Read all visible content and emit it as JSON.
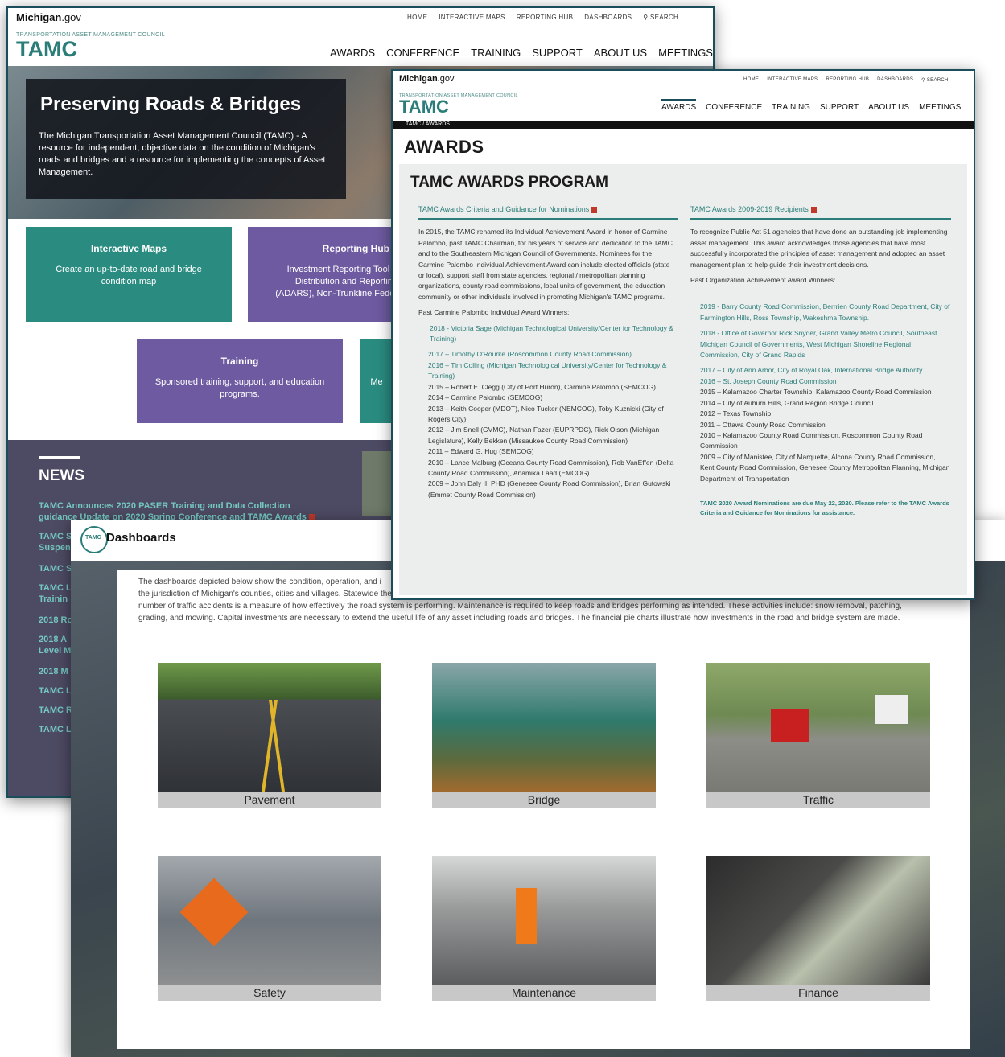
{
  "home": {
    "brand": {
      "michigan": "Michigan",
      "gov": ".gov",
      "subtitle": "TRANSPORTATION ASSET MANAGEMENT COUNCIL",
      "tamc": "TAMC"
    },
    "util_nav": [
      "HOME",
      "INTERACTIVE MAPS",
      "REPORTING HUB",
      "DASHBOARDS",
      "SEARCH"
    ],
    "main_nav": [
      "AWARDS",
      "CONFERENCE",
      "TRAINING",
      "SUPPORT",
      "ABOUT US",
      "MEETINGS"
    ],
    "hero": {
      "title": "Preserving Roads & Bridges",
      "text": "The Michigan Transportation Asset Management Council (TAMC) - A resource for independent, objective data on the condition of Michigan's roads and bridges and a resource for implementing the concepts of Asset Management."
    },
    "tiles": [
      {
        "title": "Interactive Maps",
        "desc": "Create an up-to-date road and bridge condition map"
      },
      {
        "title": "Reporting Hub",
        "desc": "Investment Reporting Tool (I Distribution and Reporting (ADARS), Non-Trunkline Feder"
      },
      {
        "title": "Training",
        "desc": "Sponsored training, support, and education programs."
      },
      {
        "title": "",
        "desc": "Me"
      }
    ],
    "news": {
      "heading": "NEWS",
      "items": [
        "TAMC Announces 2020 PASER Training and Data Collection",
        "guidance Update on 2020 Spring Conference and TAMC Awards",
        "TAMC S",
        "Suspen",
        "TAMC S",
        "TAMC L",
        "Trainin",
        "2018 Ro",
        "2018 A",
        "Level M",
        "2018 M",
        "TAMC L",
        "TAMC R",
        "TAMC L"
      ]
    }
  },
  "awards": {
    "brand": {
      "michigan": "Michigan",
      "gov": ".gov",
      "subtitle": "TRANSPORTATION ASSET MANAGEMENT COUNCIL",
      "tamc": "TAMC"
    },
    "util_nav": [
      "HOME",
      "INTERACTIVE MAPS",
      "REPORTING HUB",
      "DASHBOARDS",
      "SEARCH"
    ],
    "main_nav": [
      "AWARDS",
      "CONFERENCE",
      "TRAINING",
      "SUPPORT",
      "ABOUT US",
      "MEETINGS"
    ],
    "breadcrumb": "TAMC / AWARDS",
    "page_title": "AWARDS",
    "program_title": "TAMC AWARDS PROGRAM",
    "left": {
      "header": "TAMC Awards Criteria and Guidance for Nominations",
      "intro": "In 2015, the TAMC renamed its Individual Achievement Award in honor of Carmine Palombo, past TAMC Chairman, for his years of service and dedication to the TAMC and to the Southeastern Michigan Council of Governments. Nominees for the Carmine Palombo Individual Achievement Award can include elected officials (state or local), support staff from state agencies, regional / metropolitan planning organizations, county road commissions, local units of government, the education community or other individuals involved in promoting Michigan's TAMC programs.",
      "past_label": "Past Carmine Palombo Individual Award Winners:",
      "winner_2018": "2018 - Victoria Sage (Michigan Technological University/Center for Technology & Training)",
      "winners": [
        "2017 – Timothy O'Rourke (Roscommon County Road Commission)",
        "2016 – Tim Colling (Michigan Technological University/Center for Technology & Training)",
        "2015 – Robert E. Clegg (City of Port Huron), Carmine Palombo (SEMCOG)",
        "2014 – Carmine Palombo (SEMCOG)",
        "2013 – Keith Cooper (MDOT), Nico Tucker (NEMCOG), Toby Kuznicki (City of Rogers City)",
        "2012 – Jim Snell (GVMC), Nathan Fazer (EUPRPDC), Rick Olson (Michigan Legislature), Kelly Bekken (Missaukee County Road Commission)",
        "2011 – Edward G. Hug (SEMCOG)",
        "2010 – Lance Malburg (Oceana County Road Commission), Rob VanEffen (Delta County Road Commission), Anamika Laad (EMCOG)",
        "2009 – John Daly II, PHD (Genesee County Road Commission), Brian Gutowski (Emmet County Road Commission)"
      ]
    },
    "right": {
      "header": "TAMC Awards 2009-2019 Recipients",
      "intro": "To recognize Public Act 51 agencies that have done an outstanding job implementing asset management. This award acknowledges those agencies that have most successfully incorporated the principles of asset management and adopted an asset management plan to help guide their investment decisions.",
      "past_label": "Past Organization Achievement Award Winners:",
      "winner_2019": "2019 - Barry County Road Commission, Berrrien County Road Department, City of Farmington Hills, Ross Township, Wakeshma Township.",
      "winner_2018": "2018 - Office of Governor Rick Snyder, Grand Valley Metro Council, Southeast Michigan Council of Governments, West Michigan Shoreline Regional Commission, City of Grand Rapids",
      "winners": [
        "2017 – City of Ann Arbor, City of Royal Oak, International Bridge Authority",
        "2016 – St. Joseph County Road Commission",
        "2015 – Kalamazoo Charter Township, Kalamazoo County Road Commission",
        "2014 – City of Auburn Hills, Grand Region Bridge Council",
        "2012 – Texas Township",
        "2011 – Ottawa County Road Commission",
        "2010 – Kalamazoo County Road Commission, Roscommon County Road Commission",
        "2009 – City of Manistee, City of Marquette, Alcona County Road Commission, Kent County Road Commission, Genesee County Metropolitan Planning, Michigan Department of Transportation"
      ],
      "note": "TAMC 2020 Award Nominations are due May 22, 2020.  Please refer to the TAMC Awards Criteria and Guidance for Nominations for assistance."
    }
  },
  "dashboards": {
    "logo_text": "TAMC",
    "title": "Dashboards",
    "intro_lines": [
      "The dashboards depicted below show the condition, operation, and i",
      "the jurisdiction of Michigan's counties, cities and villages. Statewide there are over 10,000 public road bridges. Bridge conditions are based on biennial inspections of state, county, city and village owned bridges. The",
      "number of traffic accidents is a measure of how effectively the road system is performing. Maintenance is required to keep roads and bridges performing as intended. These activities include: snow removal, patching,",
      "grading, and mowing. Capital investments are necessary to extend the useful life of any asset including roads and bridges. The financial pie charts illustrate how investments in the road and bridge system are made."
    ],
    "cards": [
      "Pavement",
      "Bridge",
      "Traffic",
      "Safety",
      "Maintenance",
      "Finance"
    ]
  },
  "colors": {
    "teal": "#2a7d78",
    "purple": "#6d5aa0",
    "news_bg": "#4d4a63",
    "link_teal": "#74c8c0"
  },
  "icons": [
    "search-icon",
    "pdf-icon",
    "tamc-logo-icon"
  ]
}
